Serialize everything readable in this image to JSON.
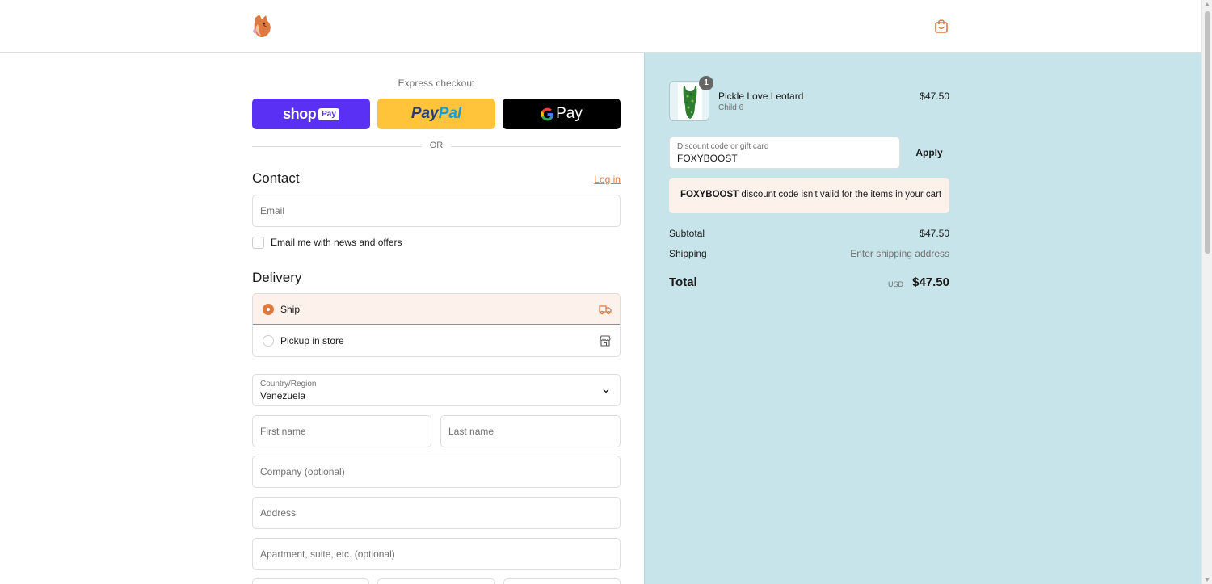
{
  "colors": {
    "accent": "#e0793f",
    "summary_bg": "#c6e4e9",
    "shop_pay": "#5a31f4",
    "paypal": "#ffc439",
    "gpay": "#000000"
  },
  "header": {
    "logo_icon": "fox-logo-icon",
    "cart_icon": "shopping-bag-icon"
  },
  "express": {
    "title": "Express checkout",
    "shop_word": "shop",
    "shop_pay_badge": "Pay",
    "paypal_part1": "Pay",
    "paypal_part2": "Pal",
    "gpay_label": "Pay",
    "or_text": "OR"
  },
  "contact": {
    "heading": "Contact",
    "login_label": "Log in",
    "email_placeholder": "Email",
    "news_checkbox_label": "Email me with news and offers",
    "news_checked": false
  },
  "delivery": {
    "heading": "Delivery",
    "options": [
      {
        "label": "Ship",
        "selected": true,
        "icon": "truck-icon"
      },
      {
        "label": "Pickup in store",
        "selected": false,
        "icon": "store-icon"
      }
    ],
    "country_label": "Country/Region",
    "country_value": "Venezuela",
    "first_name_placeholder": "First name",
    "last_name_placeholder": "Last name",
    "company_placeholder": "Company (optional)",
    "address_placeholder": "Address",
    "apartment_placeholder": "Apartment, suite, etc. (optional)"
  },
  "summary": {
    "item": {
      "name": "Pickle Love Leotard",
      "variant": "Child 6",
      "price": "$47.50",
      "quantity": "1"
    },
    "discount_label": "Discount code or gift card",
    "discount_value": "FOXYBOOST",
    "apply_label": "Apply",
    "notice_code": "FOXYBOOST",
    "notice_text": " discount code isn't valid for the items in your cart",
    "subtotal_label": "Subtotal",
    "subtotal_value": "$47.50",
    "shipping_label": "Shipping",
    "shipping_value": "Enter shipping address",
    "total_label": "Total",
    "total_currency": "USD",
    "total_value": "$47.50"
  }
}
